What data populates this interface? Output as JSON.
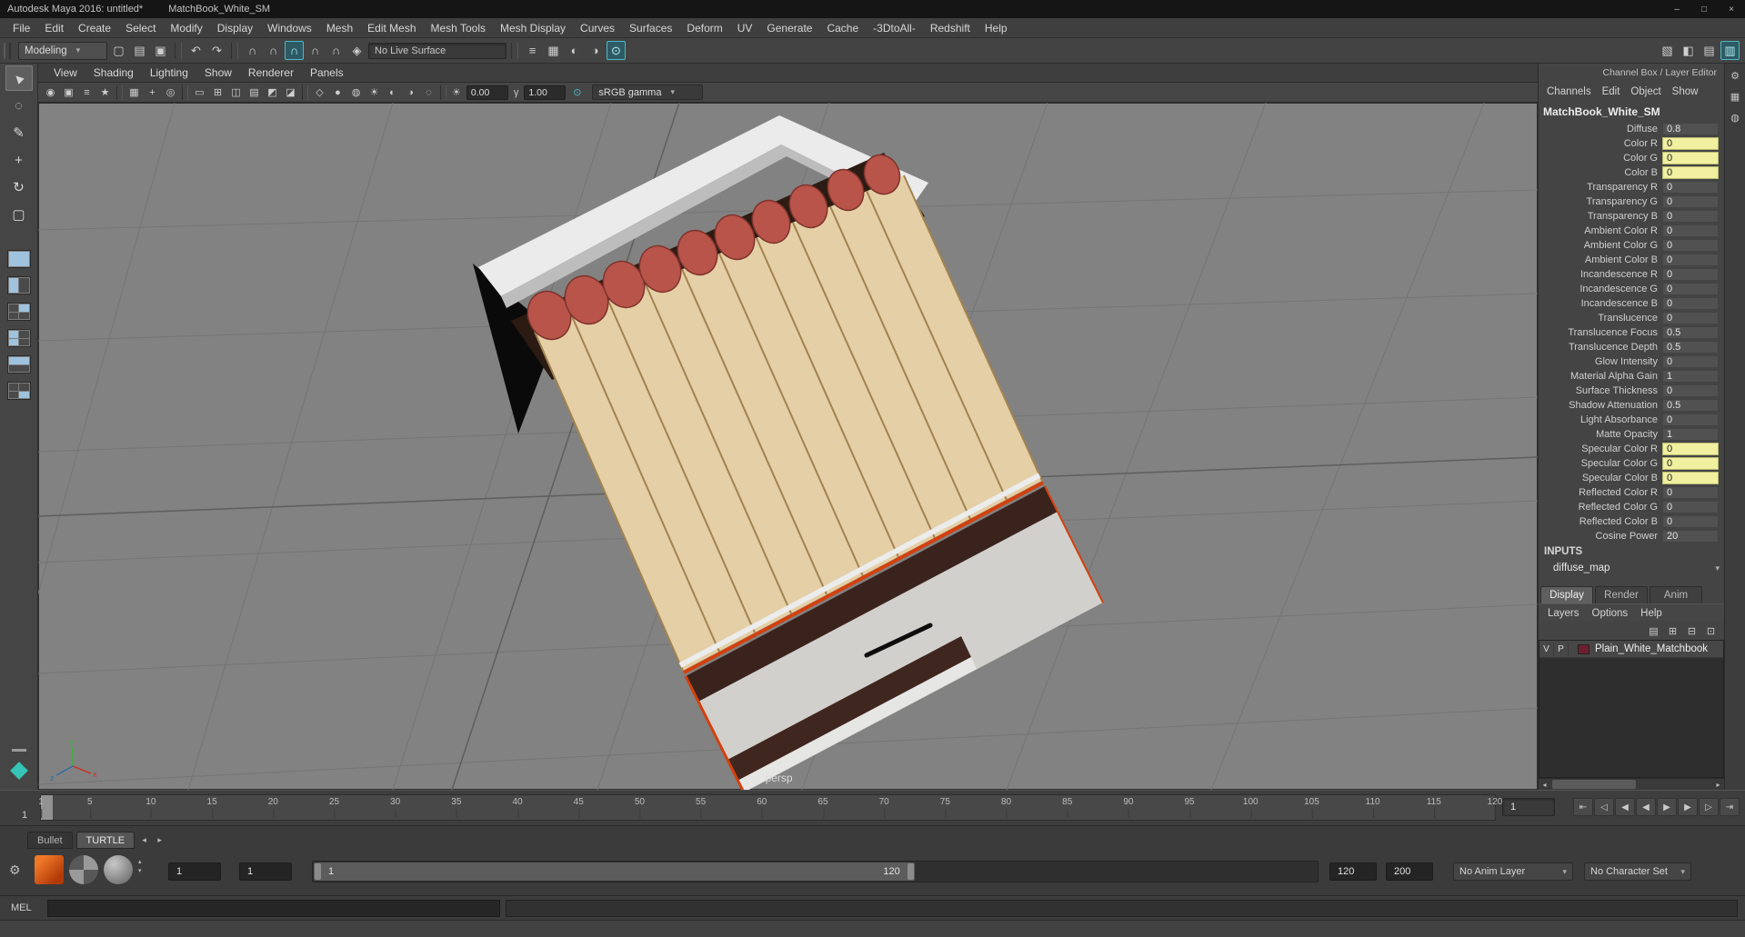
{
  "colors": {
    "accent-teal": "#4fb8c6",
    "keyed-yellow": "#f0f0a0",
    "viewport-gray": "#828282",
    "layer-swatch": "#6e1f2e"
  },
  "ui": {
    "caret": "▾",
    "scroll_left": "◂",
    "scroll_right": "▸",
    "stepper_up": "▴",
    "stepper_down": "▾"
  },
  "window": {
    "title_left": "Autodesk Maya 2016: untitled*",
    "title_right": "MatchBook_White_SM",
    "controls": [
      {
        "name": "minimize-button",
        "glyph": "–"
      },
      {
        "name": "maximize-button",
        "glyph": "□"
      },
      {
        "name": "close-button",
        "glyph": "×"
      }
    ]
  },
  "menu_bar": {
    "items": [
      "File",
      "Edit",
      "Create",
      "Select",
      "Modify",
      "Display",
      "Windows",
      "Mesh",
      "Edit Mesh",
      "Mesh Tools",
      "Mesh Display",
      "Curves",
      "Surfaces",
      "Deform",
      "UV",
      "Generate",
      "Cache",
      "-3DtoAll-",
      "Redshift",
      "Help"
    ]
  },
  "status_line": {
    "menu_set": "Modeling",
    "live_surface": "No Live Surface",
    "icons_left": [
      {
        "name": "new-scene-icon",
        "glyph": "▢"
      },
      {
        "name": "open-scene-icon",
        "glyph": "▤"
      },
      {
        "name": "save-scene-icon",
        "glyph": "▣"
      },
      {
        "name": "separator",
        "sep": true,
        "inter": "false"
      },
      {
        "name": "undo-icon",
        "glyph": "↶"
      },
      {
        "name": "redo-icon",
        "glyph": "↷"
      },
      {
        "name": "separator",
        "sep": true,
        "inter": "false"
      },
      {
        "name": "snap-to-grids-icon",
        "glyph": "∩"
      },
      {
        "name": "snap-to-curves-icon",
        "glyph": "∩"
      },
      {
        "name": "snap-to-points-icon",
        "glyph": "∩",
        "accent": true
      },
      {
        "name": "snap-to-projected-center-icon",
        "glyph": "∩"
      },
      {
        "name": "snap-to-view-planes-icon",
        "glyph": "∩"
      },
      {
        "name": "make-object-live-icon",
        "glyph": "◈"
      }
    ],
    "icons_right": [
      {
        "name": "separator",
        "sep": true,
        "inter": "false"
      },
      {
        "name": "construction-history-icon",
        "glyph": "≡"
      },
      {
        "name": "open-render-view-icon",
        "glyph": "▦"
      },
      {
        "name": "render-current-frame-icon",
        "glyph": "◐"
      },
      {
        "name": "ipr-render-icon",
        "glyph": "◑"
      },
      {
        "name": "render-settings-icon",
        "glyph": "⊙",
        "accent": true
      }
    ],
    "icons_far": [
      {
        "name": "sidebar-modeling-toolkit-icon",
        "glyph": "▧"
      },
      {
        "name": "sidebar-attribute-editor-icon",
        "glyph": "◧"
      },
      {
        "name": "sidebar-tool-settings-icon",
        "glyph": "▤"
      },
      {
        "name": "sidebar-channel-box-icon",
        "glyph": "▥",
        "accent": true
      }
    ]
  },
  "toolbox": {
    "tools": [
      {
        "name": "select-tool",
        "glyph": "▲",
        "rot": true,
        "active": true
      },
      {
        "name": "lasso-select-tool",
        "glyph": "◌"
      },
      {
        "name": "paint-select-tool",
        "glyph": "✎"
      },
      {
        "name": "move-tool",
        "glyph": "+"
      },
      {
        "name": "rotate-tool",
        "glyph": "↻"
      },
      {
        "name": "scale-tool",
        "glyph": "▢"
      }
    ]
  },
  "panel_menu": {
    "items": [
      "View",
      "Shading",
      "Lighting",
      "Show",
      "Renderer",
      "Panels"
    ]
  },
  "viewport_toolbar": {
    "icons": [
      {
        "name": "select-camera-icon",
        "glyph": "◉"
      },
      {
        "name": "lock-camera-icon",
        "glyph": "▣"
      },
      {
        "name": "camera-attributes-icon",
        "glyph": "≡"
      },
      {
        "name": "bookmarks-icon",
        "glyph": "★"
      },
      {
        "name": "separator",
        "sep": true,
        "inter": "false"
      },
      {
        "name": "image-plane-icon",
        "glyph": "▦"
      },
      {
        "name": "two-d-pan-zoom-icon",
        "glyph": "+"
      },
      {
        "name": "oversampling-icon",
        "glyph": "◎"
      },
      {
        "name": "separator",
        "sep": true,
        "inter": "false"
      },
      {
        "name": "film-gate-icon",
        "glyph": "▭"
      },
      {
        "name": "resolution-gate-icon",
        "glyph": "⊞"
      },
      {
        "name": "gate-mask-icon",
        "glyph": "◫"
      },
      {
        "name": "field-chart-icon",
        "glyph": "▤"
      },
      {
        "name": "safe-action-icon",
        "glyph": "◩"
      },
      {
        "name": "safe-title-icon",
        "glyph": "◪"
      },
      {
        "name": "separator",
        "sep": true,
        "inter": "false"
      },
      {
        "name": "wireframe-mode-icon",
        "glyph": "◇"
      },
      {
        "name": "shaded-mode-icon",
        "glyph": "●"
      },
      {
        "name": "textured-mode-icon",
        "glyph": "◍"
      },
      {
        "name": "use-all-lights-icon",
        "glyph": "☀"
      },
      {
        "name": "shadows-icon",
        "glyph": "◐"
      },
      {
        "name": "screen-space-ao-icon",
        "glyph": "◑"
      },
      {
        "name": "motion-blur-icon",
        "glyph": "◌"
      },
      {
        "name": "separator",
        "sep": true,
        "inter": "false"
      }
    ],
    "exposure_icon": "☀",
    "exposure": "0.00",
    "gamma_icon": "γ",
    "gamma": "1.00",
    "color_management_icon": "⊙",
    "color_space": "sRGB gamma"
  },
  "viewport": {
    "camera_label": "persp",
    "axis": {
      "x": "x",
      "y": "y",
      "z": "z"
    }
  },
  "channel_box": {
    "header": "Channel Box / Layer Editor",
    "menus": [
      "Channels",
      "Edit",
      "Object",
      "Show"
    ],
    "node_name": "MatchBook_White_SM",
    "attributes": [
      {
        "label": "Diffuse",
        "value": "0.8"
      },
      {
        "label": "Color R",
        "value": "0",
        "highlight": true
      },
      {
        "label": "Color G",
        "value": "0",
        "highlight": true
      },
      {
        "label": "Color B",
        "value": "0",
        "highlight": true
      },
      {
        "label": "Transparency R",
        "value": "0"
      },
      {
        "label": "Transparency G",
        "value": "0"
      },
      {
        "label": "Transparency B",
        "value": "0"
      },
      {
        "label": "Ambient Color R",
        "value": "0"
      },
      {
        "label": "Ambient Color G",
        "value": "0"
      },
      {
        "label": "Ambient Color B",
        "value": "0"
      },
      {
        "label": "Incandescence R",
        "value": "0"
      },
      {
        "label": "Incandescence G",
        "value": "0"
      },
      {
        "label": "Incandescence B",
        "value": "0"
      },
      {
        "label": "Translucence",
        "value": "0"
      },
      {
        "label": "Translucence Focus",
        "value": "0.5"
      },
      {
        "label": "Translucence Depth",
        "value": "0.5"
      },
      {
        "label": "Glow Intensity",
        "value": "0"
      },
      {
        "label": "Material Alpha Gain",
        "value": "1"
      },
      {
        "label": "Surface Thickness",
        "value": "0"
      },
      {
        "label": "Shadow Attenuation",
        "value": "0.5"
      },
      {
        "label": "Light Absorbance",
        "value": "0"
      },
      {
        "label": "Matte Opacity",
        "value": "1"
      },
      {
        "label": "Specular Color R",
        "value": "0",
        "highlight": true
      },
      {
        "label": "Specular Color G",
        "value": "0",
        "highlight": true
      },
      {
        "label": "Specular Color B",
        "value": "0",
        "highlight": true
      },
      {
        "label": "Reflected Color R",
        "value": "0"
      },
      {
        "label": "Reflected Color G",
        "value": "0"
      },
      {
        "label": "Reflected Color B",
        "value": "0"
      },
      {
        "label": "Cosine Power",
        "value": "20"
      }
    ],
    "inputs_header": "INPUTS",
    "input_node": "diffuse_map"
  },
  "layer_editor": {
    "tabs": [
      {
        "label": "Display",
        "active": true
      },
      {
        "label": "Render"
      },
      {
        "label": "Anim"
      }
    ],
    "menus": [
      "Layers",
      "Options",
      "Help"
    ],
    "icons": [
      {
        "name": "layer-sort-icon",
        "glyph": "▤"
      },
      {
        "name": "create-empty-layer-icon",
        "glyph": "⊞"
      },
      {
        "name": "create-layer-assign-selected-icon",
        "glyph": "⊟"
      },
      {
        "name": "create-layer-from-selected-icon",
        "glyph": "⊡"
      }
    ],
    "layer": {
      "visibility": "V",
      "playback": "P",
      "name": "Plain_White_Matchbook"
    }
  },
  "timeline": {
    "current_frame": "1",
    "ticks": [
      {
        "f": 1
      },
      {
        "f": 5
      },
      {
        "f": 10
      },
      {
        "f": 15
      },
      {
        "f": 20
      },
      {
        "f": 25
      },
      {
        "f": 30
      },
      {
        "f": 35
      },
      {
        "f": 40
      },
      {
        "f": 45
      },
      {
        "f": 50
      },
      {
        "f": 55
      },
      {
        "f": 60
      },
      {
        "f": 65
      },
      {
        "f": 70
      },
      {
        "f": 75
      },
      {
        "f": 80
      },
      {
        "f": 85
      },
      {
        "f": 90
      },
      {
        "f": 95
      },
      {
        "f": 100
      },
      {
        "f": 105
      },
      {
        "f": 110
      },
      {
        "f": 115
      },
      {
        "f": 120
      }
    ],
    "playback": [
      {
        "name": "go-to-start-button",
        "glyph": "⇤"
      },
      {
        "name": "step-back-key-button",
        "glyph": "◁"
      },
      {
        "name": "step-back-frame-button",
        "glyph": "◀"
      },
      {
        "name": "play-backwards-button",
        "glyph": "◀"
      },
      {
        "name": "play-forwards-button",
        "glyph": "▶"
      },
      {
        "name": "step-forward-frame-button",
        "glyph": "▶"
      },
      {
        "name": "step-forward-key-button",
        "glyph": "▷"
      },
      {
        "name": "go-to-end-button",
        "glyph": "⇥"
      }
    ]
  },
  "shelf": {
    "tabs": [
      {
        "label": "Bullet"
      },
      {
        "label": "TURTLE",
        "active": true
      }
    ]
  },
  "range_slider": {
    "animation_start": "1",
    "playback_start": "1",
    "bar_start": "1",
    "bar_end": "120",
    "playback_end": "120",
    "animation_end": "200",
    "anim_layer": "No Anim Layer",
    "character_set": "No Character Set",
    "icons": [
      {
        "name": "auto-keyframe-icon",
        "glyph": "⊙"
      },
      {
        "name": "animation-preferences-icon",
        "glyph": "⚙"
      }
    ]
  },
  "right_strip_icons": [
    {
      "name": "channel-box-settings-icon",
      "glyph": "⚙"
    },
    {
      "name": "channel-slider-mode-icon",
      "glyph": "▦"
    },
    {
      "name": "channel-manip-icon",
      "glyph": "◍"
    }
  ],
  "command_line": {
    "label": "MEL"
  }
}
